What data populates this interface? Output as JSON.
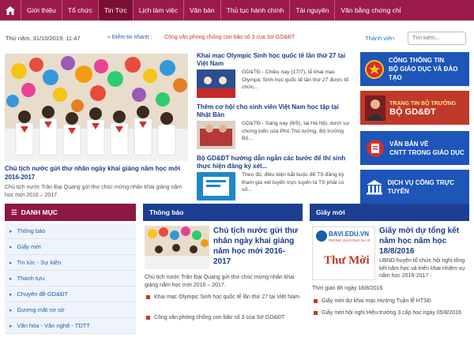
{
  "nav": {
    "items": [
      {
        "label": "Giới thiệu"
      },
      {
        "label": "Tổ chức"
      },
      {
        "label": "Tin Tức",
        "active": true
      },
      {
        "label": "Lịch làm việc"
      },
      {
        "label": "Văn bản"
      },
      {
        "label": "Thủ tục hành chính"
      },
      {
        "label": "Tài nguyên"
      },
      {
        "label": "Văn bằng chứng chỉ"
      }
    ]
  },
  "infobar": {
    "date": "Thứ năm, 31/10/2019, 11:47",
    "hot_label": "Điểm tin nhanh :",
    "hot_text": "Công văn phòng chống con bão số 3 của Sở GD&ĐT",
    "member_link": "Thành viên",
    "search_placeholder": "Tìm kiếm..."
  },
  "hero": {
    "title": "Chủ tịch nước gửi thư nhân ngày khai giảng năm học mới 2016-2017",
    "summary": "Chủ tịch nước Trần Đại Quang gửi thư chúc mừng nhân khai giảng năm học mới 2016 – 2017."
  },
  "news": [
    {
      "title": "Khai mạc Olympic Sinh học quốc tế lần thứ 27 tại Việt Nam",
      "desc": "GD&TĐ - Chiều nay (17/7), lễ khai mạc Olympic Sinh học quốc tế lần thứ 27 được tổ chức..."
    },
    {
      "title": "Thêm cơ hội cho sinh viên Việt Nam học tập tại Nhật Bản",
      "desc": "GD&TĐ - Sáng nay (6/5), tại Hà Nội, dưới sự chứng kiến của Phó Thủ tướng, Bộ trưởng Bộ..."
    },
    {
      "title": "Bộ GD&ĐT hướng dẫn ngắn các bước để thí sinh thực hiện đăng ký xét...",
      "desc": "Theo đó, điều kiện bắt buộc để TS đăng ký tham gia xét tuyển trực tuyến là TS phải có số..."
    }
  ],
  "banners": [
    {
      "line1": "CỔNG THÔNG TIN",
      "line2": "BỘ GIÁO DỤC VÀ ĐÀO TẠO",
      "icon": "emblem-icon"
    },
    {
      "line1": "TRANG TIN BỘ TRƯỞNG",
      "line2": "BỘ GD&ĐT",
      "icon": "portrait-icon"
    },
    {
      "line1": "VĂN BẢN VỀ",
      "line2": "CNTT TRONG GIÁO DỤC",
      "icon": "document-icon"
    },
    {
      "line1": "DỊCH VỤ CÔNG TRỰC TUYẾN",
      "line2": "",
      "icon": "building-icon"
    }
  ],
  "categories": {
    "header": "DANH MỤC",
    "items": [
      "Thông báo",
      "Giấy mời",
      "Tin tức - Sự kiện",
      "Thanh tựu",
      "Chuyên đề GD&ĐT",
      "Gương mặt cơ sở",
      "Văn hóa - Văn nghệ - TDTT"
    ]
  },
  "announcements": {
    "header": "Thông báo",
    "title": "Chủ tịch nước gửi thư nhân ngày khai giảng năm học mới 2016-2017",
    "summary": "Chủ tịch nước Trần Đại Quang gửi thư chúc mừng nhân khai giảng năm học mới 2016 – 2017.",
    "list": [
      "Khai mạc Olympic Sinh học quốc tế lần thứ 27 tại Việt Nam",
      "Công văn phòng chống con bão số 3 của Sở GD&ĐT"
    ]
  },
  "invites": {
    "header": "Giấy mời",
    "title": "Giấy mời dự tổng kết năm học năm học 18/8/2016",
    "summary": "UBND huyện tổ chức hội nghị tổng kết năm học và triển khai nhiệm vụ năm học 2016-2017 -",
    "date": "Thời gian 8h ngày 18/8/2016",
    "image_site": "BAVI.EDU.VN",
    "image_sub": "PHÒNG GIÁO DỤC BA VÌ",
    "image_word": "Thư Mời",
    "list": [
      "Giấy mời dự khai mạc Hướng Tuần lễ HTSĐ",
      "Giấy mời hội nghị Hiệu trưởng 3 cấp học ngày 05/8/2016"
    ]
  }
}
